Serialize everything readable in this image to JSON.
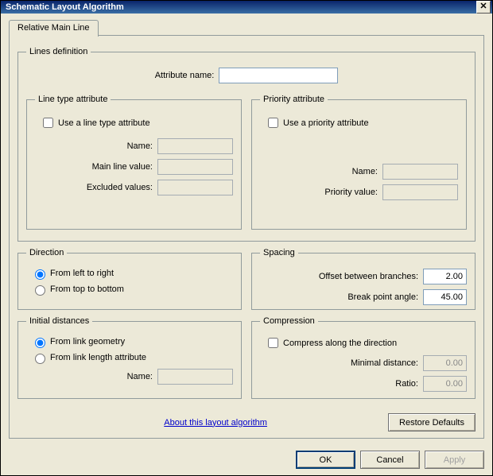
{
  "window": {
    "title": "Schematic Layout Algorithm"
  },
  "tabs": {
    "relative_main_line": "Relative Main Line"
  },
  "lines_def": {
    "legend": "Lines definition",
    "attr_name_label": "Attribute name:",
    "attr_name_value": "",
    "line_type": {
      "legend": "Line type attribute",
      "use_label": "Use a line type attribute",
      "use_checked": false,
      "name_label": "Name:",
      "name_value": "",
      "main_line_label": "Main line value:",
      "main_line_value": "",
      "excluded_label": "Excluded values:",
      "excluded_value": ""
    },
    "priority": {
      "legend": "Priority attribute",
      "use_label": "Use a priority attribute",
      "use_checked": false,
      "name_label": "Name:",
      "name_value": "",
      "value_label": "Priority value:",
      "value_value": ""
    }
  },
  "direction": {
    "legend": "Direction",
    "lr_label": "From left to right",
    "tb_label": "From top to bottom",
    "selected": "lr"
  },
  "spacing": {
    "legend": "Spacing",
    "offset_label": "Offset between branches:",
    "offset_value": "2.00",
    "break_label": "Break point angle:",
    "break_value": "45.00"
  },
  "initial": {
    "legend": "Initial distances",
    "geom_label": "From link geometry",
    "len_label": "From link length attribute",
    "selected": "geom",
    "name_label": "Name:",
    "name_value": ""
  },
  "compression": {
    "legend": "Compression",
    "compress_label": "Compress along the direction",
    "compress_checked": false,
    "min_label": "Minimal distance:",
    "min_value": "0.00",
    "ratio_label": "Ratio:",
    "ratio_value": "0.00"
  },
  "footer": {
    "about_link": "About this layout algorithm",
    "restore": "Restore Defaults",
    "ok": "OK",
    "cancel": "Cancel",
    "apply": "Apply"
  }
}
